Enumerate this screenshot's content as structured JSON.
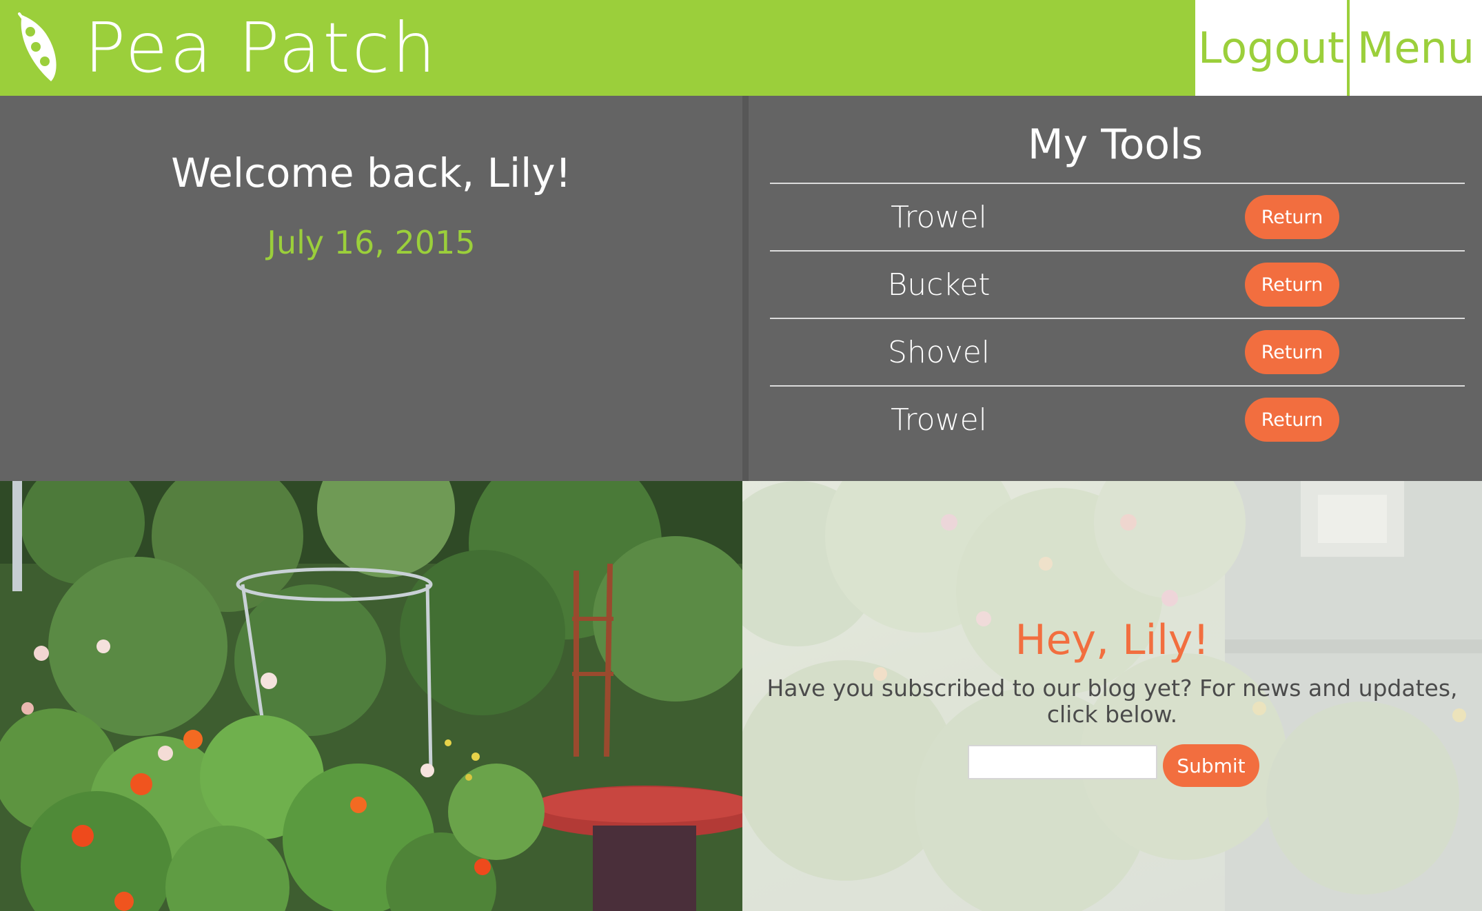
{
  "header": {
    "brand": "Pea Patch",
    "logo_icon": "pea-pod-icon",
    "logout_label": "Logout",
    "menu_label": "Menu"
  },
  "welcome": {
    "greeting": "Welcome back, Lily!",
    "date": "July 16, 2015"
  },
  "tools": {
    "title": "My Tools",
    "items": [
      {
        "name": "Trowel",
        "action": "Return"
      },
      {
        "name": "Bucket",
        "action": "Return"
      },
      {
        "name": "Shovel",
        "action": "Return"
      },
      {
        "name": "Trowel",
        "action": "Return"
      }
    ]
  },
  "blog": {
    "title": "Hey, Lily!",
    "message": "Have you subscribed to our blog yet? For news and updates, click below.",
    "email_value": "",
    "submit_label": "Submit"
  },
  "colors": {
    "brand_green": "#9bcf3b",
    "accent_orange": "#f26e3f",
    "panel_gray": "#646464"
  }
}
